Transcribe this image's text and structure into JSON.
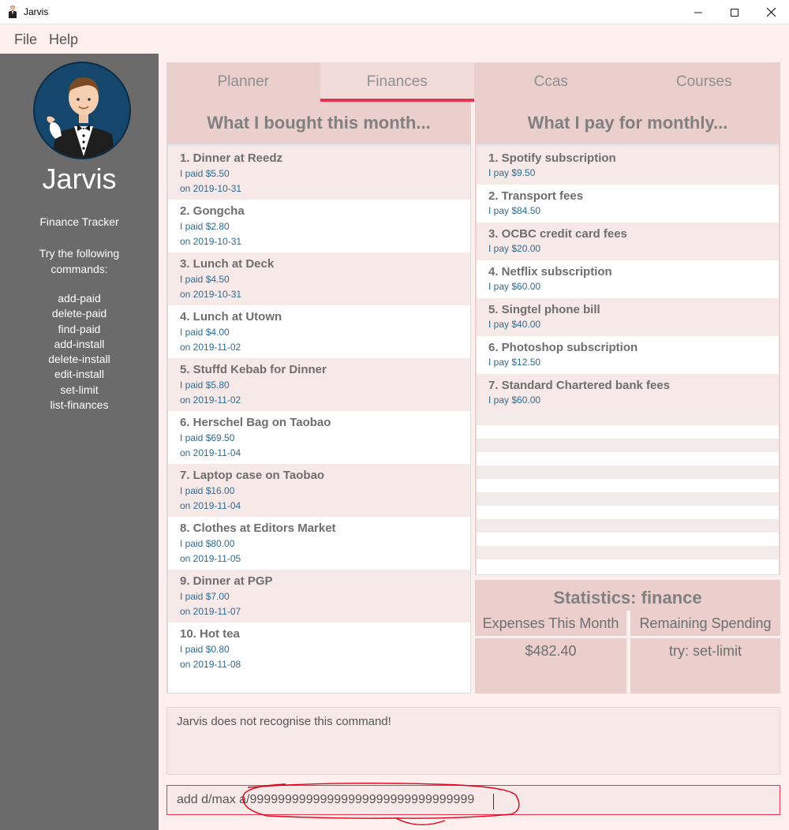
{
  "window": {
    "title": "Jarvis"
  },
  "menu": {
    "file": "File",
    "help": "Help"
  },
  "sidebar": {
    "name": "Jarvis",
    "subtitle": "Finance Tracker",
    "try_text": "Try the following commands:",
    "commands": [
      "add-paid",
      "delete-paid",
      "find-paid",
      "add-install",
      "delete-install",
      "edit-install",
      "set-limit",
      "list-finances"
    ]
  },
  "tabs": [
    {
      "label": "Planner"
    },
    {
      "label": "Finances",
      "active": true
    },
    {
      "label": "Ccas"
    },
    {
      "label": "Courses"
    }
  ],
  "purchases": {
    "header": "What I bought this month...",
    "items": [
      {
        "title": "1. Dinner at Reedz",
        "paid": "I paid $5.50",
        "date": "on 2019-10-31"
      },
      {
        "title": "2. Gongcha",
        "paid": "I paid $2.80",
        "date": "on 2019-10-31"
      },
      {
        "title": "3. Lunch at Deck",
        "paid": "I paid $4.50",
        "date": "on 2019-10-31"
      },
      {
        "title": "4. Lunch at Utown",
        "paid": "I paid $4.00",
        "date": "on 2019-11-02"
      },
      {
        "title": "5. Stuffd Kebab for Dinner",
        "paid": "I paid $5.80",
        "date": "on 2019-11-02"
      },
      {
        "title": "6. Herschel Bag on Taobao",
        "paid": "I paid $69.50",
        "date": "on 2019-11-04"
      },
      {
        "title": "7. Laptop case on Taobao",
        "paid": "I paid $16.00",
        "date": "on 2019-11-04"
      },
      {
        "title": "8. Clothes at Editors Market",
        "paid": "I paid $80.00",
        "date": "on 2019-11-05"
      },
      {
        "title": "9. Dinner at PGP",
        "paid": "I paid $7.00",
        "date": "on 2019-11-07"
      },
      {
        "title": "10. Hot tea",
        "paid": "I paid $0.80",
        "date": "on 2019-11-08"
      }
    ]
  },
  "monthly": {
    "header": "What I pay for monthly...",
    "items": [
      {
        "title": "1. Spotify subscription",
        "pay": "I pay $9.50"
      },
      {
        "title": "2. Transport fees",
        "pay": "I pay $84.50"
      },
      {
        "title": "3. OCBC credit card fees",
        "pay": "I pay $20.00"
      },
      {
        "title": "4. Netflix subscription",
        "pay": "I pay $60.00"
      },
      {
        "title": "5. Singtel phone bill",
        "pay": "I pay $40.00"
      },
      {
        "title": "6. Photoshop subscription",
        "pay": "I pay $12.50"
      },
      {
        "title": "7. Standard Chartered bank fees",
        "pay": "I pay $60.00"
      }
    ]
  },
  "statistics": {
    "header": "Statistics: finance",
    "expenses_label": "Expenses This Month",
    "expenses_value": "$482.40",
    "remaining_label": "Remaining Spending",
    "remaining_value": "try: set-limit"
  },
  "result_message": "Jarvis does not recognise this command!",
  "command_input": {
    "value": "add d/max a/99999999999999999999999999999999"
  },
  "colors": {
    "accent": "#e8344e",
    "sidebar": "#6b6b6b",
    "panel": "#eacfcd",
    "background": "#fcefed",
    "detail_text": "#2e6b94"
  }
}
